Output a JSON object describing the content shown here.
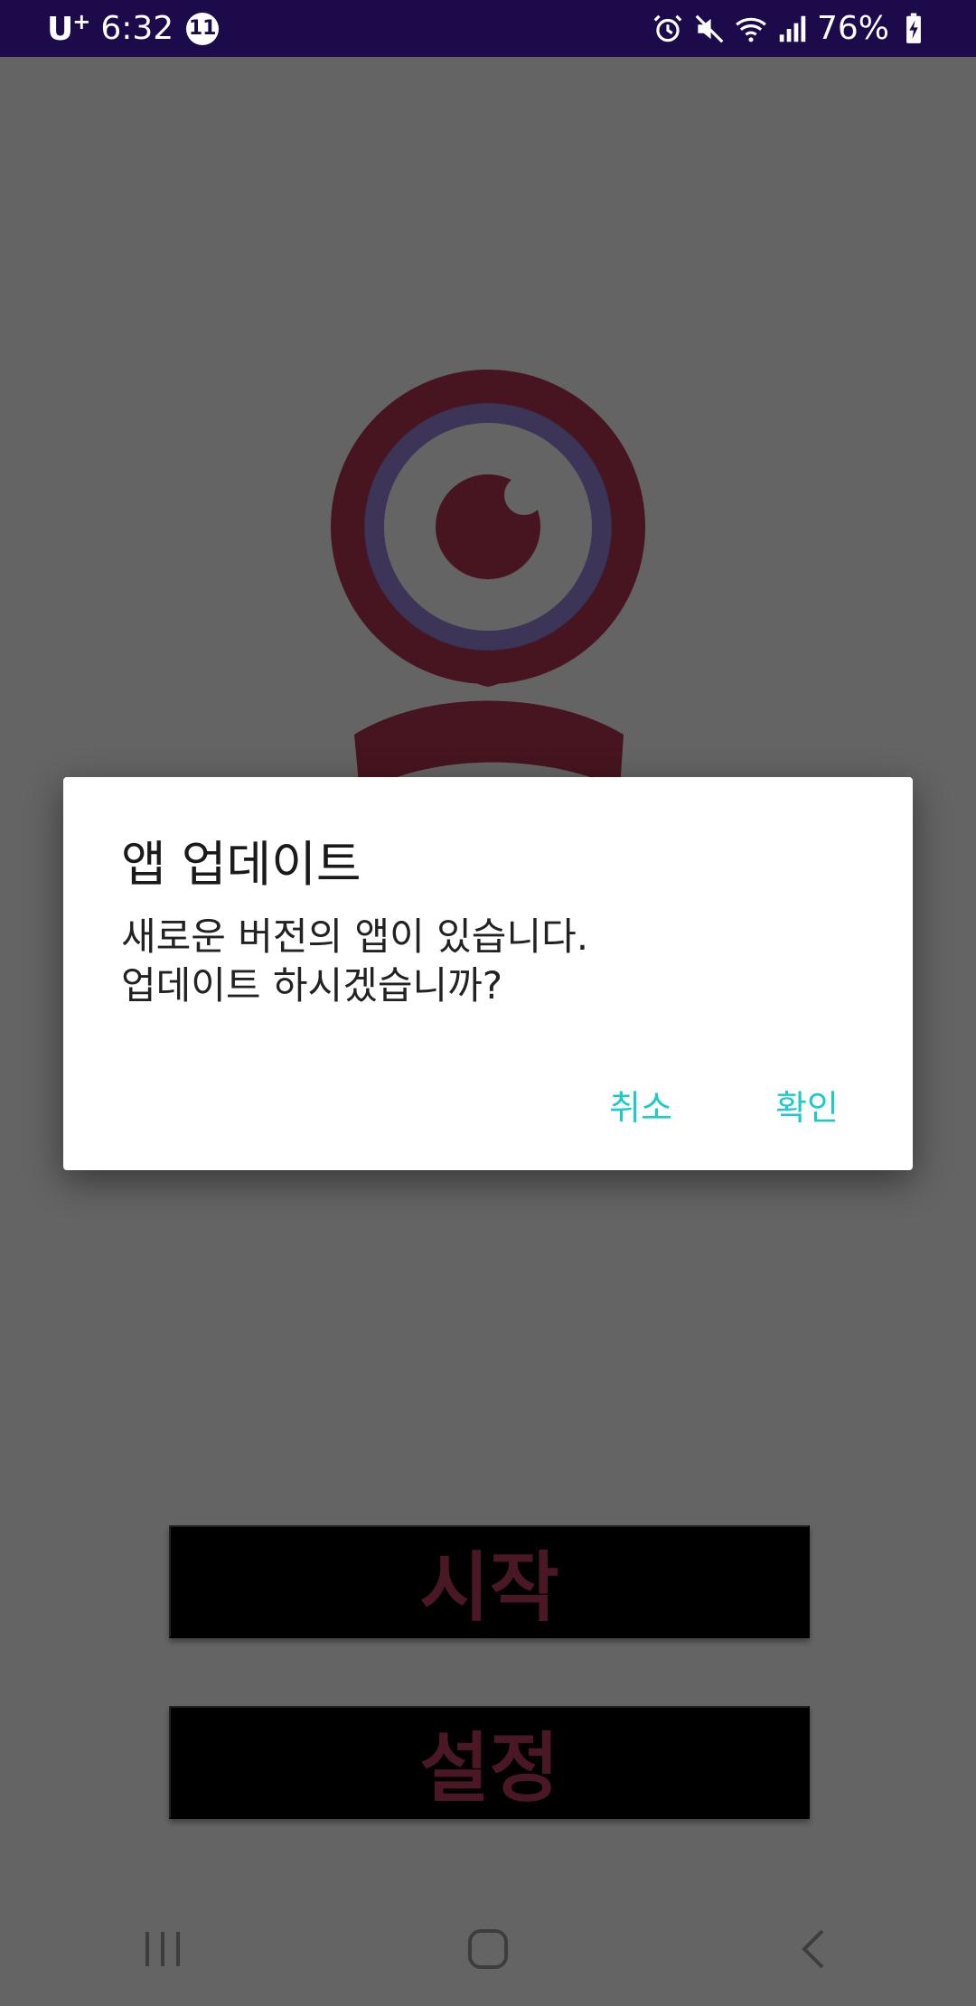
{
  "status_bar": {
    "carrier": "U",
    "carrier_plus": "+",
    "time": "6:32",
    "notification_count": "11",
    "battery": "76%",
    "icons": [
      "alarm-icon",
      "mute-icon",
      "wifi-icon",
      "signal-icon",
      "battery-charging-icon"
    ]
  },
  "app": {
    "logo_icon": "webcam-eye-icon",
    "start_label": "시작",
    "settings_label": "설정",
    "colors": {
      "accent": "#b83a5e",
      "button_bg": "#000000",
      "logo": "#b0354f",
      "status_bar": "#1d0a4a"
    }
  },
  "dialog": {
    "title": "앱 업데이트",
    "message_line1": "새로운 버전의 앱이 있습니다.",
    "message_line2": "업데이트 하시겠습니까?",
    "cancel_label": "취소",
    "confirm_label": "확인",
    "button_color": "#20c9c9"
  },
  "nav_bar": {
    "icons": [
      "recent-apps-icon",
      "home-icon",
      "back-icon"
    ]
  }
}
